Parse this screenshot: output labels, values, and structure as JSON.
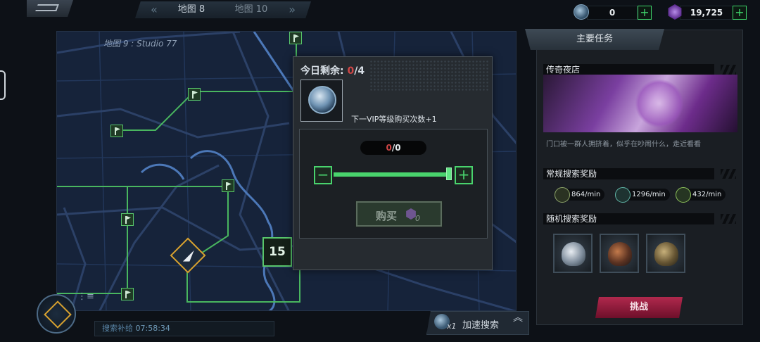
{
  "top_bar": {
    "prev_map": "地图 8",
    "next_map": "地图 10",
    "currency_1": "0",
    "currency_2": "19,725",
    "plus": "+"
  },
  "map": {
    "title": "地图 9 : Studio 77",
    "level_badge": "15"
  },
  "bottom_left": {
    "menu_glyph": "⋮≡",
    "search_supply_label": "搜索补给",
    "search_supply_time": "07:58:34"
  },
  "speed_search": {
    "count": "x1",
    "label": "加速搜索",
    "chevrons": "︽"
  },
  "purchase_popup": {
    "remaining_label": "今日剩余: ",
    "remaining_current": "0",
    "remaining_total": "/4",
    "vip_note": "下一VIP等级购买次数+1",
    "qty_current": "0",
    "qty_total": "/0",
    "minus": "−",
    "plus": "+",
    "buy_label": "购买",
    "buy_cost": "0",
    "slider_fraction": 1.0
  },
  "right_panel": {
    "header": "主要任务",
    "story_title": "传奇夜店",
    "story_desc": "门口被一群人拥挤着，似乎在吵闹什么，走近看看",
    "regular_rewards_title": "常规搜索奖励",
    "regular_rewards": [
      {
        "icon": "coin-icon",
        "value": "864/min"
      },
      {
        "icon": "target-icon",
        "value": "1296/min"
      },
      {
        "icon": "exp-icon",
        "value": "432/min"
      }
    ],
    "random_rewards_title": "随机搜索奖励",
    "random_rewards": [
      {
        "icon": "white-helmet-icon"
      },
      {
        "icon": "orange-helmet-icon"
      },
      {
        "icon": "camo-helmet-icon"
      }
    ],
    "challenge_label": "挑战"
  },
  "colors": {
    "accent_green": "#49d36d",
    "warning_red": "#d04646",
    "challenge_red": "#b0294d",
    "map_bg": "#16233a"
  }
}
